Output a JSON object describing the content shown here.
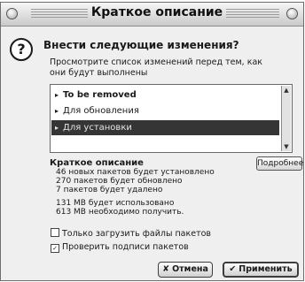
{
  "window": {
    "title": "Краткое описание"
  },
  "dialog": {
    "heading": "Внести следующие изменения?",
    "description": "Просмотрите список изменений перед тем, как они будут выполнены",
    "question_icon": "question-icon"
  },
  "changes_list": {
    "items": [
      {
        "label": "To be removed",
        "bold": true,
        "selected": false
      },
      {
        "label": "Для обновления",
        "bold": false,
        "selected": false
      },
      {
        "label": "Для установки",
        "bold": false,
        "selected": true
      }
    ]
  },
  "summary": {
    "title": "Краткое описание",
    "details_button": "Подробнее",
    "lines": [
      "46 новых пакетов будет установлено",
      "270 пакетов будет обновлено",
      "7 пакетов будет удалено",
      "131 MB будет использовано",
      "613 MB необходимо получить."
    ]
  },
  "options": {
    "download_only": {
      "label": "Только загрузить файлы пакетов",
      "checked": false
    },
    "verify_signatures": {
      "label": "Проверить подписи пакетов",
      "checked": true
    }
  },
  "buttons": {
    "cancel": "Отмена",
    "apply": "Применить"
  },
  "colors": {
    "selection": "#353535",
    "window_bg": "#efefef"
  }
}
